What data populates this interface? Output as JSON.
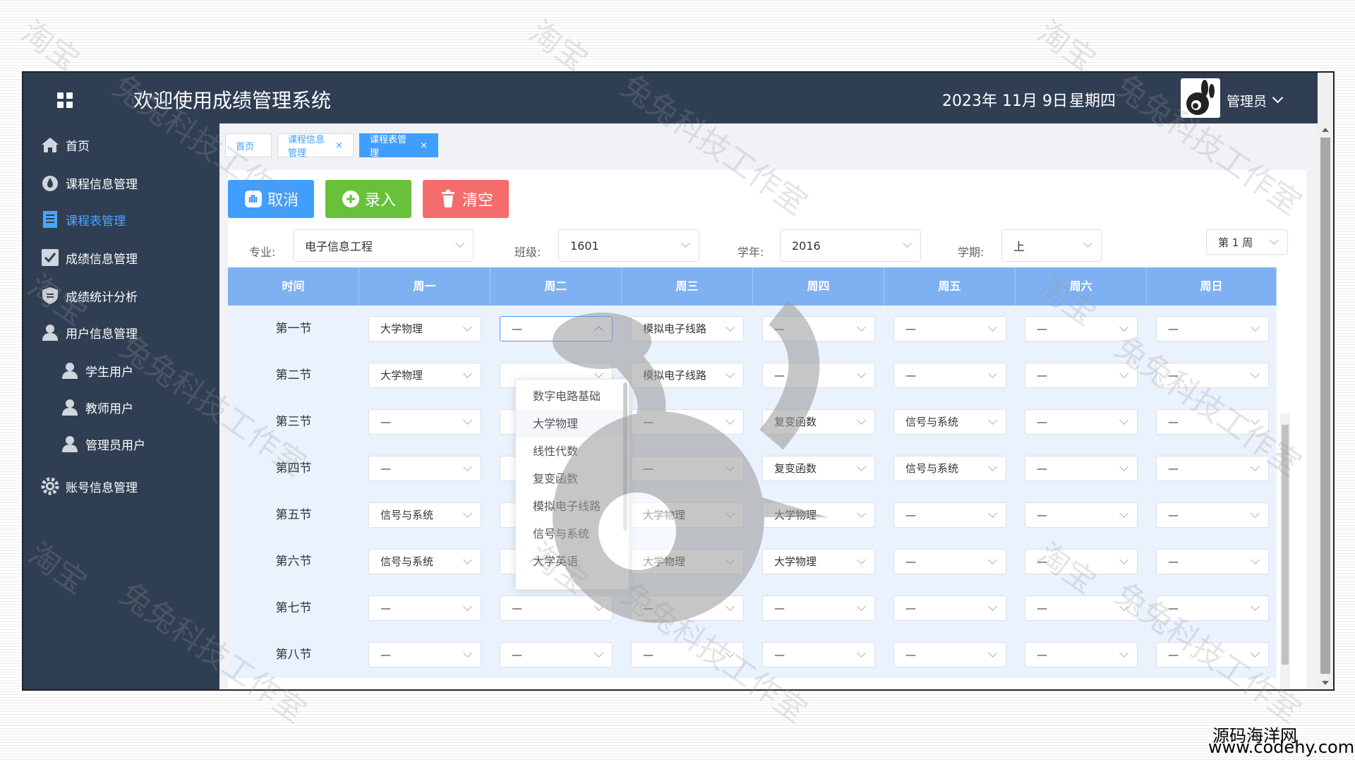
{
  "header": {
    "title": "欢迎使用成绩管理系统",
    "date": "2023年 11月 9日",
    "weekday": "星期四",
    "user": "管理员"
  },
  "sidebar": {
    "items": [
      {
        "label": "首页",
        "icon": "home-icon"
      },
      {
        "label": "课程信息管理",
        "icon": "drop-icon"
      },
      {
        "label": "课程表管理",
        "icon": "document-icon",
        "active": true
      },
      {
        "label": "成绩信息管理",
        "icon": "check-icon"
      },
      {
        "label": "成绩统计分析",
        "icon": "shield-icon"
      },
      {
        "label": "用户信息管理",
        "icon": "user-icon"
      },
      {
        "label": "学生用户",
        "icon": "user-icon"
      },
      {
        "label": "教师用户",
        "icon": "user-icon"
      },
      {
        "label": "管理员用户",
        "icon": "user-icon"
      },
      {
        "label": "账号信息管理",
        "icon": "gear-icon"
      }
    ]
  },
  "tabs": [
    {
      "label": "首页"
    },
    {
      "label": "课程信息管理",
      "close": "×"
    },
    {
      "label": "课程表管理",
      "close": "×",
      "active": true
    }
  ],
  "toolbar": {
    "cancel": "取消",
    "submit": "录入",
    "clear": "清空",
    "colors": {
      "cancel": "#409eff",
      "submit": "#67c23a",
      "clear": "#f56c6c"
    }
  },
  "filters": {
    "major_label": "专业:",
    "major_value": "电子信息工程",
    "class_label": "班级:",
    "class_value": "1601",
    "year_label": "学年:",
    "year_value": "2016",
    "term_label": "学期:",
    "term_value": "上",
    "week_value": "第 1 周"
  },
  "schedule": {
    "headers": [
      "时间",
      "周一",
      "周二",
      "周三",
      "周四",
      "周五",
      "周六",
      "周日"
    ],
    "rows": [
      {
        "time": "第一节",
        "cells": [
          "大学物理",
          "—",
          "模拟电子线路",
          "—",
          "—",
          "—",
          "—"
        ]
      },
      {
        "time": "第二节",
        "cells": [
          "大学物理",
          "",
          "模拟电子线路",
          "—",
          "—",
          "—",
          "—"
        ]
      },
      {
        "time": "第三节",
        "cells": [
          "—",
          "",
          "—",
          "复变函数",
          "信号与系统",
          "—",
          "—"
        ]
      },
      {
        "time": "第四节",
        "cells": [
          "—",
          "",
          "—",
          "复变函数",
          "信号与系统",
          "—",
          "—"
        ]
      },
      {
        "time": "第五节",
        "cells": [
          "信号与系统",
          "",
          "大学物理",
          "大学物理",
          "—",
          "—",
          "—"
        ]
      },
      {
        "time": "第六节",
        "cells": [
          "信号与系统",
          "",
          "大学物理",
          "大学物理",
          "—",
          "—",
          "—"
        ]
      },
      {
        "time": "第七节",
        "cells": [
          "—",
          "—",
          "—",
          "—",
          "—",
          "—",
          "—"
        ]
      },
      {
        "time": "第八节",
        "cells": [
          "—",
          "—",
          "—",
          "—",
          "—",
          "—",
          "—"
        ]
      }
    ]
  },
  "dropdown": {
    "options": [
      "数字电路基础",
      "大学物理",
      "线性代数",
      "复变函数",
      "模拟电子线路",
      "信号与系统",
      "大学英语"
    ]
  },
  "watermark": {
    "text1": "淘宝",
    "text2": "兔兔科技工作室"
  },
  "footer": {
    "brand": "源码海洋网",
    "url": "www.codehy.com"
  }
}
